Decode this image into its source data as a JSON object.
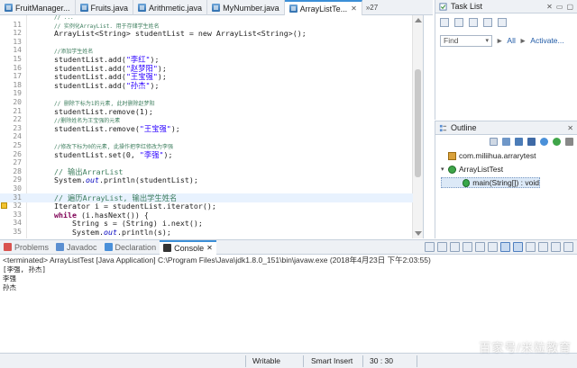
{
  "editor_tabs": [
    {
      "label": "FruitManager..."
    },
    {
      "label": "Fruits.java"
    },
    {
      "label": "Arithmetic.java"
    },
    {
      "label": "MyNumber.java"
    },
    {
      "label": "ArrayListTe...",
      "active": true
    }
  ],
  "tab_overflow": "»27",
  "code_lines": [
    {
      "num": "",
      "kind": "cm-cn",
      "text": "// ..."
    },
    {
      "num": "11",
      "kind": "cm-cn",
      "text": "// 实例化ArrayList. 用于存储学生姓名"
    },
    {
      "num": "12",
      "kind": "code",
      "text": "ArrayList<String> studentList = new ArrayList<String>();"
    },
    {
      "num": "13",
      "kind": "blank",
      "text": ""
    },
    {
      "num": "14",
      "kind": "cm-cn",
      "text": "//添加学生姓名"
    },
    {
      "num": "15",
      "kind": "add",
      "text": "studentList.add(",
      "arg": "\"李红\"",
      "tail": ");"
    },
    {
      "num": "16",
      "kind": "add",
      "text": "studentList.add(",
      "arg": "\"赵梦阳\"",
      "tail": ");"
    },
    {
      "num": "17",
      "kind": "add",
      "text": "studentList.add(",
      "arg": "\"王宝强\"",
      "tail": ");"
    },
    {
      "num": "18",
      "kind": "add",
      "text": "studentList.add(",
      "arg": "\"孙杰\"",
      "tail": ");"
    },
    {
      "num": "19",
      "kind": "blank",
      "text": ""
    },
    {
      "num": "20",
      "kind": "cm-cn",
      "text": "// 删除下标为1的元素, 此时删除赵梦阳"
    },
    {
      "num": "21",
      "kind": "plain",
      "text": "studentList.remove(1);"
    },
    {
      "num": "22",
      "kind": "cm-cn",
      "text": "//删除姓名为王宝强的元素"
    },
    {
      "num": "23",
      "kind": "add",
      "text": "studentList.remove(",
      "arg": "\"王宝强\"",
      "tail": ");"
    },
    {
      "num": "24",
      "kind": "blank",
      "text": ""
    },
    {
      "num": "25",
      "kind": "cm-cn",
      "text": "//修改下标为0的元素, 此操作把李红修改为李强"
    },
    {
      "num": "26",
      "kind": "add",
      "text": "studentList.set(0, ",
      "arg": "\"李强\"",
      "tail": ");"
    },
    {
      "num": "27",
      "kind": "blank",
      "text": ""
    },
    {
      "num": "28",
      "kind": "cm",
      "text": "// 输出ArrarList"
    },
    {
      "num": "29",
      "kind": "println",
      "text": "System.",
      "fld": "out",
      "tail": ".println(studentList);"
    },
    {
      "num": "30",
      "kind": "blank",
      "text": ""
    },
    {
      "num": "31",
      "kind": "cm",
      "text": "// 遍历ArrayList, 输出学生姓名",
      "hl": true
    },
    {
      "num": "32",
      "kind": "plain",
      "text": "Iterator i = studentList.iterator();",
      "warn": true
    },
    {
      "num": "33",
      "kind": "while",
      "text": "while",
      "tail": " (i.hasNext()) {"
    },
    {
      "num": "34",
      "kind": "plain",
      "text": "    String s = (String) i.next();"
    },
    {
      "num": "35",
      "kind": "println",
      "text": "    System.",
      "fld": "out",
      "tail": ".println(s);"
    }
  ],
  "task_list": {
    "title": "Task List",
    "find_placeholder": "Find",
    "all_label": "All",
    "activate_label": "Activate..."
  },
  "outline": {
    "title": "Outline",
    "items": [
      {
        "label": "com.miliihua.arrarytest",
        "level": 0,
        "icon": "package-icon"
      },
      {
        "label": "ArrayListTest",
        "level": 0,
        "icon": "class-icon",
        "twisty": "▾"
      },
      {
        "label": "main(String[]) : void",
        "level": 1,
        "icon": "method-icon",
        "selected": true
      }
    ]
  },
  "bottom_tabs": [
    {
      "label": "Problems"
    },
    {
      "label": "Javadoc"
    },
    {
      "label": "Declaration"
    },
    {
      "label": "Console",
      "active": true
    }
  ],
  "console": {
    "terminated": "<terminated> ArrayListTest [Java Application] C:\\Program Files\\Java\\jdk1.8.0_151\\bin\\javaw.exe (2018年4月23日 下午2:03:55)",
    "output": [
      "[李强, 孙杰]",
      "李强",
      "孙杰"
    ]
  },
  "status_bar": {
    "writable": "Writable",
    "insert_mode": "Smart Insert",
    "position": "30 : 30"
  },
  "watermark": "百家号/米粒教育",
  "colors": {
    "accent": "#3c8fd7",
    "comment": "#3f7f5f",
    "keyword": "#7f0055",
    "string": "#2a00ff",
    "field": "#0000c0"
  }
}
